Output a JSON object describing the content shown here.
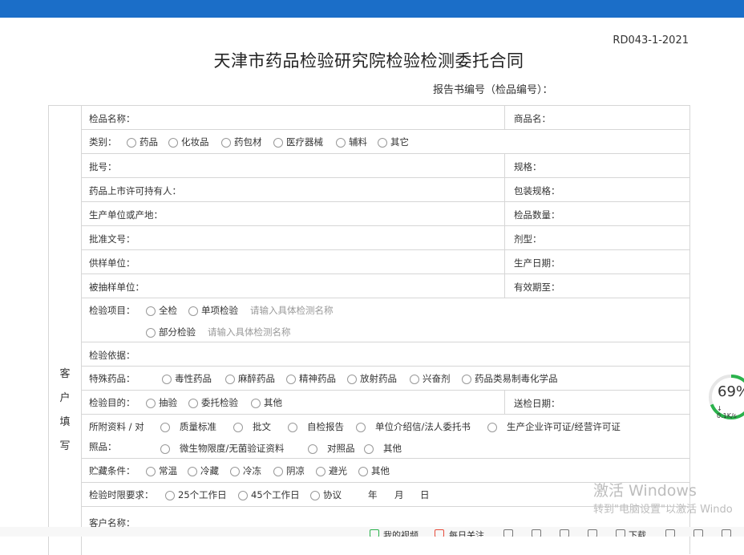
{
  "header": {
    "doc_code": "RD043-1-2021",
    "title": "天津市药品检验研究院检验检测委托合同",
    "report_no_label": "报告书编号（检品编号）："
  },
  "side_label": [
    "客",
    "户",
    "填",
    "写"
  ],
  "rows": {
    "sample_name": "检品名称：",
    "trade_name": "商品名：",
    "category_label": "类别：",
    "category_options": [
      "药品",
      "化妆品",
      "药包材",
      "医疗器械",
      "辅料",
      "其它"
    ],
    "batch_no": "批号：",
    "spec": "规格：",
    "holder": "药品上市许可持有人：",
    "package_spec": "包装规格：",
    "manufacturer": "生产单位或产地：",
    "sample_qty": "检品数量：",
    "approval_no": "批准文号：",
    "dosage_form": "剂型：",
    "supplier": "供样单位：",
    "prod_date": "生产日期：",
    "sampled_unit": "被抽样单位：",
    "expiry": "有效期至：",
    "items_label": "检验项目：",
    "item_full": "全检",
    "item_single": "单项检验",
    "item_single_ph": "请输入具体检测名称",
    "item_partial": "部分检验",
    "item_partial_ph": "请输入具体检测名称",
    "basis": "检验依据：",
    "special_label": "特殊药品：",
    "special_options": [
      "毒性药品",
      "麻醉药品",
      "精神药品",
      "放射药品",
      "兴奋剂",
      "药品类易制毒化学品"
    ],
    "purpose_label": "检验目的：",
    "purpose_options": [
      "抽验",
      "委托检验",
      "其他"
    ],
    "send_date": "送检日期：",
    "attach_label_1": "所附资料 / 对",
    "attach_label_2": "照品：",
    "attach_options_1": [
      "质量标准",
      "批文",
      "自检报告",
      "单位介绍信/法人委托书",
      "生产企业许可证/经营许可证"
    ],
    "attach_options_2": [
      "微生物限度/无菌验证资料",
      "对照品",
      "其他"
    ],
    "storage_label": "贮藏条件：",
    "storage_options": [
      "常温",
      "冷藏",
      "冷冻",
      "阴凉",
      "避光",
      "其他"
    ],
    "time_label": "检验时限要求：",
    "time_options": [
      "25个工作日",
      "45个工作日",
      "协议"
    ],
    "time_year": "年",
    "time_month": "月",
    "time_day": "日",
    "customer_name": "客户名称："
  },
  "gauge": {
    "percent": "69%",
    "speed": "0.1K/s",
    "value": 0.69,
    "color": "#2bb24c"
  },
  "watermark": {
    "line1": "激活 Windows",
    "line2": "转到\"电脑设置\"以激活 Windo"
  },
  "bottombar": {
    "video": "我的视频",
    "daily": "每日关注",
    "download": "下载"
  },
  "colors": {
    "topbar": "#1b6ec8",
    "border": "#d6d6d6",
    "placeholder": "#999999"
  }
}
